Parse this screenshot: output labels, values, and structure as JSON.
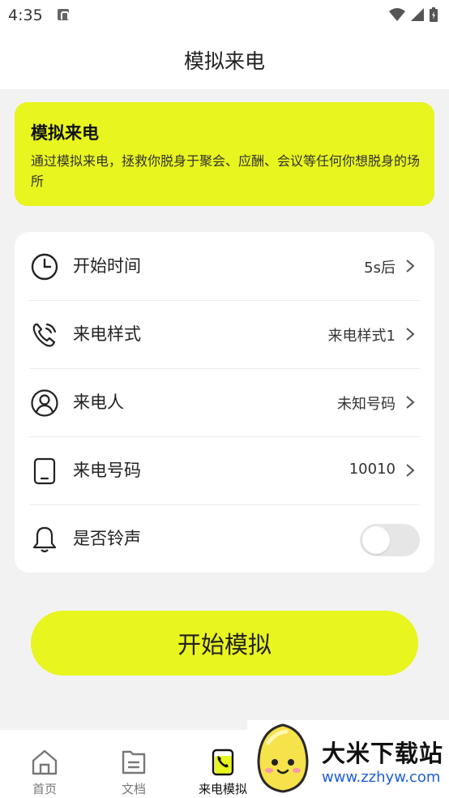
{
  "status_bar": {
    "time": "4:35"
  },
  "header": {
    "title": "模拟来电"
  },
  "banner": {
    "title": "模拟来电",
    "description": "通过模拟来电，拯救你脱身于聚会、应酬、会议等任何你想脱身的场所",
    "background_color": "#e8f51e"
  },
  "settings": {
    "rows": [
      {
        "icon": "clock-icon",
        "label": "开始时间",
        "value": "5s后"
      },
      {
        "icon": "phone-ringing-icon",
        "label": "来电样式",
        "value": "来电样式1"
      },
      {
        "icon": "user-circle-icon",
        "label": "来电人",
        "value": "未知号码"
      },
      {
        "icon": "tablet-icon",
        "label": "来电号码",
        "value": "10010"
      },
      {
        "icon": "bell-icon",
        "label": "是否铃声",
        "toggle_on": false
      }
    ]
  },
  "start_button": {
    "label": "开始模拟"
  },
  "tabbar": {
    "tabs": [
      {
        "icon": "home-icon",
        "label": "首页",
        "active": false
      },
      {
        "icon": "document-icon",
        "label": "文档",
        "active": false
      },
      {
        "icon": "phone-call-icon",
        "label": "来电模拟",
        "active": true
      }
    ]
  },
  "watermark": {
    "title": "大米下载站",
    "url": "www.zzhyw.com"
  }
}
